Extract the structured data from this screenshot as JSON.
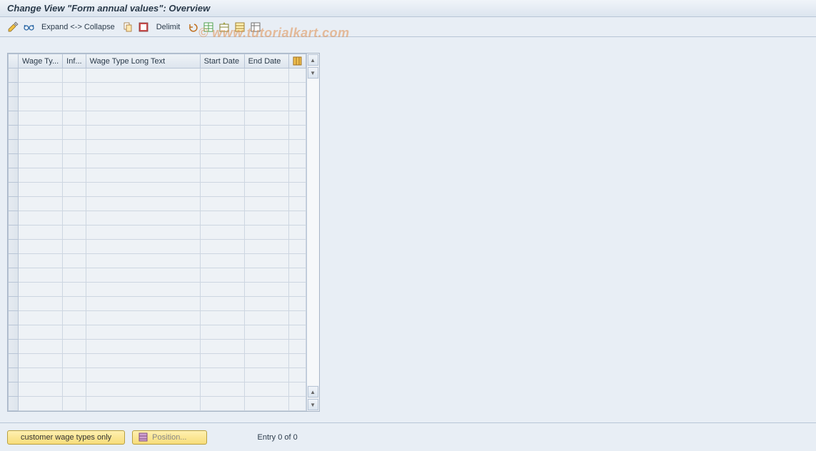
{
  "title": "Change View \"Form annual values\": Overview",
  "toolbar": {
    "expand_collapse": "Expand <-> Collapse",
    "delimit": "Delimit"
  },
  "watermark": "© www.tutorialkart.com",
  "columns": {
    "wage_type": "Wage Ty...",
    "inf": "Inf...",
    "long_text": "Wage Type Long Text",
    "start_date": "Start Date",
    "end_date": "End Date"
  },
  "rows": 24,
  "footer": {
    "customer_btn": "customer wage types only",
    "position_btn": "Position...",
    "entry_text": "Entry 0 of 0"
  }
}
